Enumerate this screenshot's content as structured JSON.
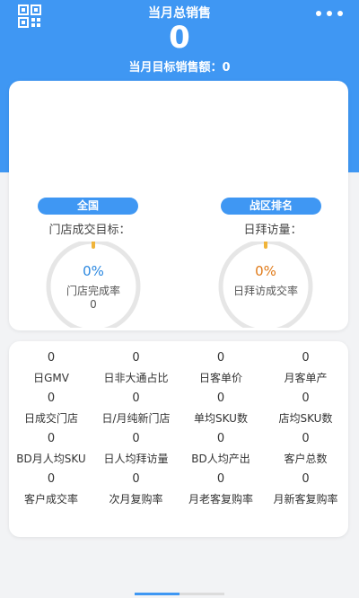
{
  "header": {
    "title": "当月总销售",
    "total_sales": "0",
    "target_text": "当月目标销售额：0",
    "icons": {
      "left": "qr-code-icon",
      "right": "more-icon"
    },
    "background": "#3f97f3"
  },
  "summary": {
    "left": {
      "tab_label": "全国",
      "metric_label": "门店成交目标：",
      "ring_percent": "0%",
      "ring_caption": "门店完成率",
      "ring_value": "0",
      "percent_color": "#2b88e0",
      "progress": 0
    },
    "right": {
      "tab_label": "战区排名",
      "metric_label": "日拜访量：",
      "ring_percent": "0%",
      "ring_caption": "日拜访成交率",
      "percent_color": "#e07a18",
      "progress": 0
    }
  },
  "metrics": [
    {
      "value": "0",
      "label": "日GMV"
    },
    {
      "value": "0",
      "label": "日非大通占比"
    },
    {
      "value": "0",
      "label": "日客单价"
    },
    {
      "value": "0",
      "label": "月客单产"
    },
    {
      "value": "0",
      "label": "日成交门店"
    },
    {
      "value": "0",
      "label": "日/月纯新门店"
    },
    {
      "value": "0",
      "label": "单均SKU数"
    },
    {
      "value": "0",
      "label": "店均SKU数"
    },
    {
      "value": "0",
      "label": "BD月人均SKU"
    },
    {
      "value": "0",
      "label": "日人均拜访量"
    },
    {
      "value": "0",
      "label": "BD人均产出"
    },
    {
      "value": "0",
      "label": "客户总数"
    },
    {
      "value": "0",
      "label": "客户成交率"
    },
    {
      "value": "0",
      "label": "次月复购率"
    },
    {
      "value": "0",
      "label": "月老客复购率"
    },
    {
      "value": "0",
      "label": "月新客复购率"
    }
  ]
}
